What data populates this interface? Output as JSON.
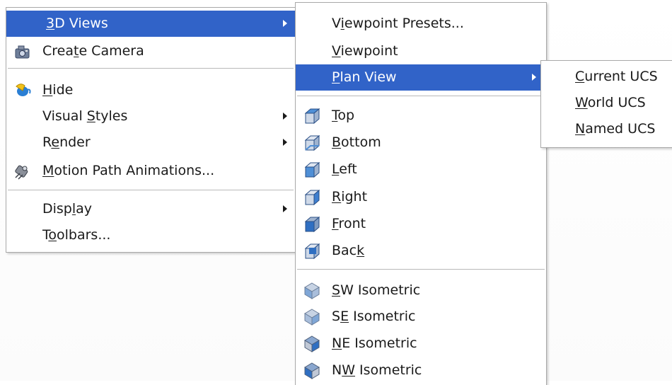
{
  "menu_main": {
    "items": [
      {
        "label": "3D Views",
        "mnemonic": "3",
        "rest": "D Views",
        "submenu": true,
        "highlighted": true
      },
      {
        "label": "Create Camera",
        "pre": "Crea",
        "mnemonic": "t",
        "rest": "e Camera",
        "icon": "camera-icon"
      },
      {
        "label": "Hide",
        "mnemonic": "H",
        "rest": "ide",
        "icon": "hide-teapot-icon"
      },
      {
        "label": "Visual Styles",
        "pre": "Visual ",
        "mnemonic": "S",
        "rest": "tyles",
        "submenu": true
      },
      {
        "label": "Render",
        "pre": "R",
        "mnemonic": "e",
        "rest": "nder",
        "submenu": true
      },
      {
        "label": "Motion Path Animations...",
        "mnemonic": "M",
        "rest": "otion Path Animations...",
        "icon": "motion-path-icon"
      },
      {
        "label": "Display",
        "pre": "Disp",
        "mnemonic": "l",
        "rest": "ay",
        "submenu": true
      },
      {
        "label": "Toolbars...",
        "pre": "T",
        "mnemonic": "o",
        "rest": "olbars..."
      }
    ]
  },
  "menu_views": {
    "items": [
      {
        "label": "Viewpoint Presets...",
        "pre": "V",
        "mnemonic": "i",
        "rest": "ewpoint Presets..."
      },
      {
        "label": "Viewpoint",
        "mnemonic": "V",
        "rest": "iewpoint"
      },
      {
        "label": "Plan View",
        "mnemonic": "P",
        "rest": "lan View",
        "submenu": true,
        "highlighted": true
      },
      {
        "label": "Top",
        "mnemonic": "T",
        "rest": "op",
        "icon": "view-top-icon"
      },
      {
        "label": "Bottom",
        "mnemonic": "B",
        "rest": "ottom",
        "icon": "view-bottom-icon"
      },
      {
        "label": "Left",
        "mnemonic": "L",
        "rest": "eft",
        "icon": "view-left-icon"
      },
      {
        "label": "Right",
        "mnemonic": "R",
        "rest": "ight",
        "icon": "view-right-icon"
      },
      {
        "label": "Front",
        "mnemonic": "F",
        "rest": "ront",
        "icon": "view-front-icon"
      },
      {
        "label": "Back",
        "pre": "Bac",
        "mnemonic": "k",
        "rest": "",
        "icon": "view-back-icon"
      },
      {
        "label": "SW Isometric",
        "mnemonic": "S",
        "rest": "W Isometric",
        "icon": "sw-isometric-icon"
      },
      {
        "label": "SE Isometric",
        "pre": "S",
        "mnemonic": "E",
        "rest": " Isometric",
        "icon": "se-isometric-icon"
      },
      {
        "label": "NE Isometric",
        "mnemonic": "N",
        "rest": "E Isometric",
        "icon": "ne-isometric-icon"
      },
      {
        "label": "NW Isometric",
        "pre": "N",
        "mnemonic": "W",
        "rest": " Isometric",
        "icon": "nw-isometric-icon"
      }
    ]
  },
  "menu_plan": {
    "items": [
      {
        "label": "Current UCS",
        "mnemonic": "C",
        "rest": "urrent UCS"
      },
      {
        "label": "World UCS",
        "mnemonic": "W",
        "rest": "orld UCS"
      },
      {
        "label": "Named UCS",
        "mnemonic": "N",
        "rest": "amed UCS"
      }
    ]
  },
  "colors": {
    "highlight": "#3163c8",
    "text": "#1a1a1a",
    "highlight_text": "#ffffff"
  }
}
